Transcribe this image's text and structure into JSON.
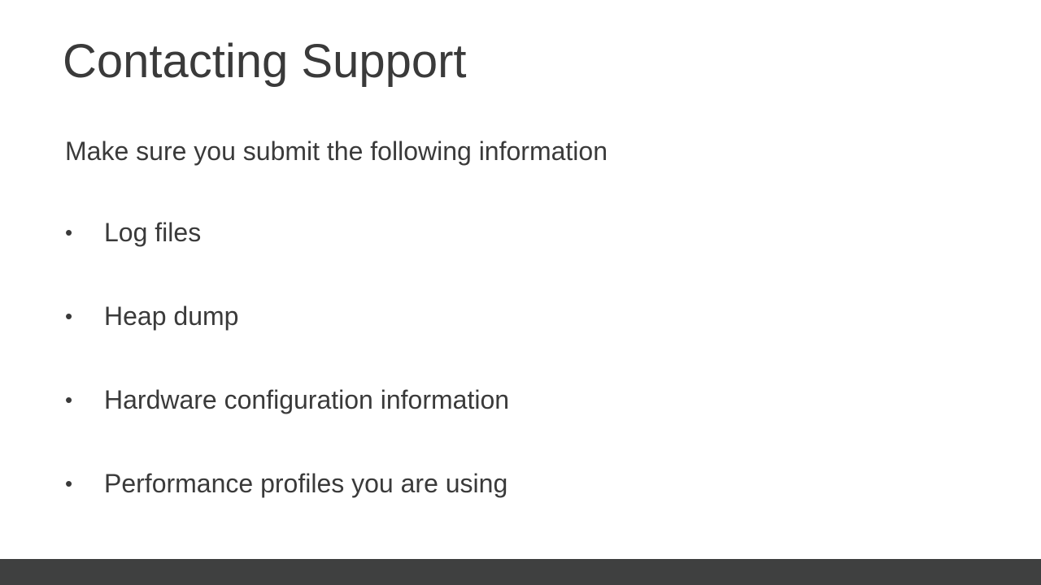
{
  "slide": {
    "title": "Contacting Support",
    "intro": "Make sure you submit the following information",
    "bullet_glyph": "•",
    "bullets": [
      "Log files",
      "Heap dump",
      "Hardware configuration information",
      "Performance profiles you are using"
    ]
  },
  "colors": {
    "background": "#ffffff",
    "text": "#3a3a3a",
    "footer_bar": "#3f4040"
  }
}
